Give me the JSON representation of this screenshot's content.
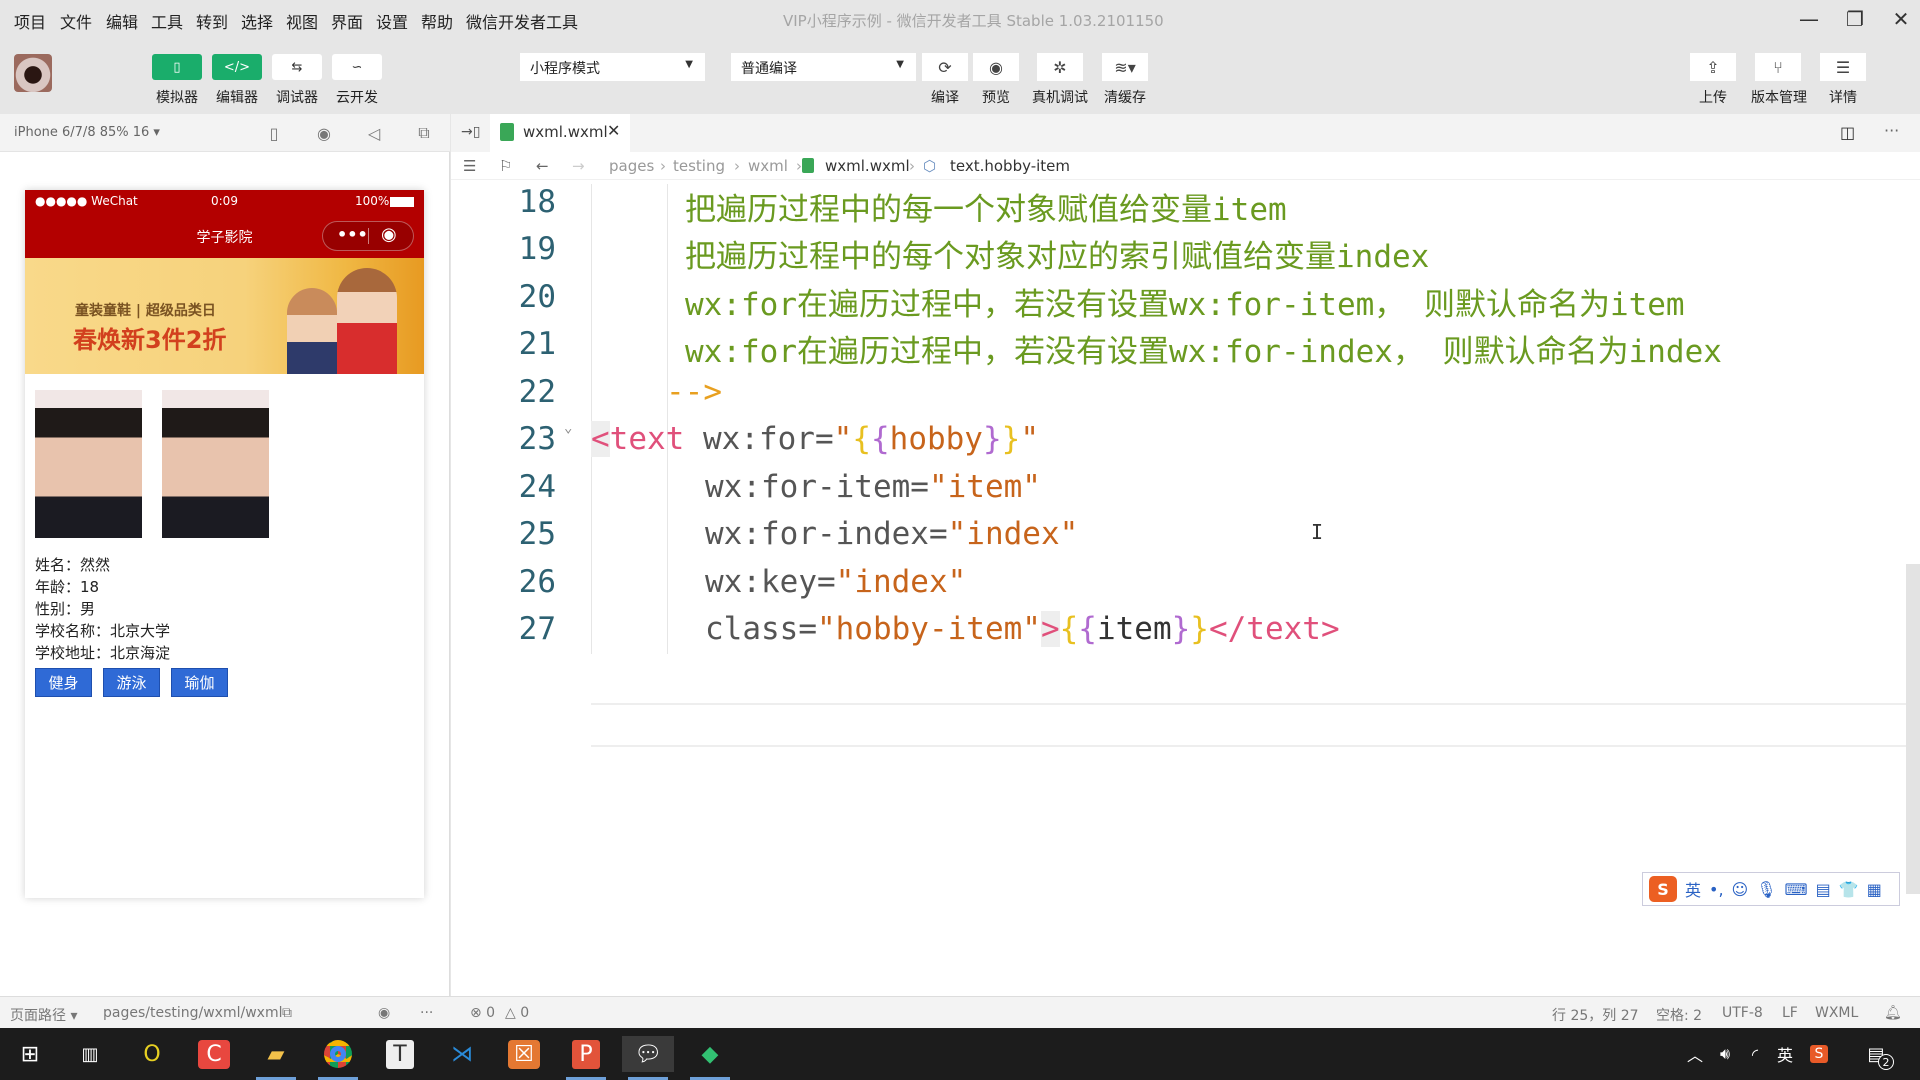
{
  "window": {
    "title": "VIP小程序示例 - 微信开发者工具 Stable 1.03.2101150",
    "menu": [
      "项目",
      "文件",
      "编辑",
      "工具",
      "转到",
      "选择",
      "视图",
      "界面",
      "设置",
      "帮助",
      "微信开发者工具"
    ],
    "controls": {
      "minimize": "—",
      "maximize": "❐",
      "close": "✕"
    }
  },
  "toolbar": {
    "mode_buttons": [
      {
        "label": "模拟器",
        "icon": "phone-icon",
        "glyph": "▯",
        "active": true
      },
      {
        "label": "编辑器",
        "icon": "code-icon",
        "glyph": "</>",
        "active": true
      },
      {
        "label": "调试器",
        "icon": "debug-toggle-icon",
        "glyph": "⇆",
        "active": false
      },
      {
        "label": "云开发",
        "icon": "cloud-icon",
        "glyph": "∽",
        "active": false
      }
    ],
    "mode_select": "小程序模式",
    "compile_select": "普通编译",
    "actions": [
      {
        "label": "编译",
        "icon": "refresh-icon",
        "glyph": "⟳"
      },
      {
        "label": "预览",
        "icon": "eye-icon",
        "glyph": "◉"
      },
      {
        "label": "真机调试",
        "icon": "bug-icon",
        "glyph": "✲"
      },
      {
        "label": "清缓存",
        "icon": "layers-icon",
        "glyph": "≋▾"
      }
    ],
    "right_actions": [
      {
        "label": "上传",
        "icon": "upload-icon",
        "glyph": "⇪"
      },
      {
        "label": "版本管理",
        "icon": "branch-icon",
        "glyph": "⑂"
      },
      {
        "label": "详情",
        "icon": "menu-icon",
        "glyph": "☰"
      }
    ]
  },
  "simulator": {
    "device": "iPhone 6/7/8 85% 16 ▾",
    "status": {
      "carrier": "●●●●● WeChat",
      "time": "0:09",
      "battery": "100%"
    },
    "nav_title": "学子影院",
    "banner": {
      "line1": "童装童鞋 | 超级品类日",
      "line2": "春焕新3件2折"
    },
    "info": [
      {
        "label": "姓名：",
        "value": "然然"
      },
      {
        "label": "年龄：",
        "value": "18"
      },
      {
        "label": "性别：",
        "value": "男"
      },
      {
        "label": "学校名称：",
        "value": "北京大学"
      },
      {
        "label": "学校地址：",
        "value": "北京海淀"
      }
    ],
    "hobbies": [
      "健身",
      "游泳",
      "瑜伽"
    ]
  },
  "editor": {
    "tab": "wxml.wxml",
    "breadcrumb": [
      "pages",
      "testing",
      "wxml",
      "wxml.wxml",
      "text.hobby-item"
    ],
    "lines": [
      {
        "n": "18",
        "text": "把遍历过程中的每一个对象赋值给变量item"
      },
      {
        "n": "19",
        "text": "把遍历过程中的每个对象对应的索引赋值给变量index"
      },
      {
        "n": "20",
        "text": "wx:for在遍历过程中，若没有设置wx:for-item， 则默认命名为item"
      },
      {
        "n": "21",
        "text": "wx:for在遍历过程中，若没有设置wx:for-index， 则默认命名为index"
      },
      {
        "n": "22",
        "text": "-->"
      },
      {
        "n": "23",
        "tag_open": "<",
        "tag": "text",
        "attr": " wx:for=",
        "q1": "\"",
        "b1": "{",
        "b2": "{",
        "var": "hobby",
        "b3": "}",
        "b4": "}",
        "q2": "\""
      },
      {
        "n": "24",
        "attr": "wx:for-item=",
        "val": "\"item\""
      },
      {
        "n": "25",
        "attr": "wx:for-index=",
        "val": "\"index\""
      },
      {
        "n": "26",
        "attr": "wx:key=",
        "val": "\"index\""
      },
      {
        "n": "27",
        "attr": "class=",
        "val": "\"hobby-item\"",
        "gt": ">",
        "b1": "{",
        "b2": "{",
        "var": "item",
        "b3": "}",
        "b4": "}",
        "close": "</",
        "ctag": "text",
        "cgt": ">"
      }
    ]
  },
  "ime": {
    "logo": "S",
    "lang": "英",
    "items": [
      "•,",
      "☺",
      "🎙",
      "⌨",
      "▤",
      "👕",
      "▦"
    ]
  },
  "statusbar": {
    "page_path_label": "页面路径 ▾",
    "page_path": "pages/testing/wxml/wxml",
    "errors": "⊗ 0",
    "warnings": "△ 0",
    "cursor": "行 25，列 27",
    "indent": "空格: 2",
    "encoding": "UTF-8",
    "eol": "LF",
    "language": "WXML"
  },
  "taskbar": {
    "tray_lang": "英",
    "notifications": "2"
  }
}
